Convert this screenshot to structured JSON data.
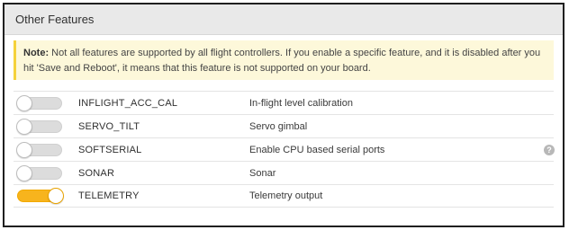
{
  "panel": {
    "title": "Other Features"
  },
  "note": {
    "label": "Note:",
    "text": " Not all features are supported by all flight controllers. If you enable a specific feature, and it is disabled after you hit 'Save and Reboot', it means that this feature is not supported on your board."
  },
  "features": [
    {
      "name": "INFLIGHT_ACC_CAL",
      "description": "In-flight level calibration",
      "enabled": false
    },
    {
      "name": "SERVO_TILT",
      "description": "Servo gimbal",
      "enabled": false
    },
    {
      "name": "SOFTSERIAL",
      "description": "Enable CPU based serial ports",
      "enabled": false,
      "help_icon": "question-mark-icon",
      "help_text": "?"
    },
    {
      "name": "SONAR",
      "description": "Sonar",
      "enabled": false
    },
    {
      "name": "TELEMETRY",
      "description": "Telemetry output",
      "enabled": true
    }
  ],
  "colors": {
    "toggle_on": "#f7b41d",
    "toggle_off": "#dcdcdc",
    "note_background": "#fdf8da",
    "note_border": "#f5d23a"
  }
}
